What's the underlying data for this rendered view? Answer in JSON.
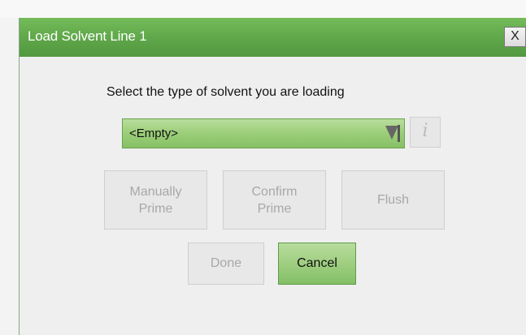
{
  "dialog": {
    "title": "Load Solvent Line 1",
    "close_label": "X",
    "prompt": "Select the type of solvent you are loading",
    "solvent_select": {
      "value": "<Empty>",
      "icon": "dropdown-arrow"
    },
    "info_button": {
      "label": "i",
      "icon": "info-icon"
    },
    "buttons": {
      "manual_prime_line1": "Manually",
      "manual_prime_line2": "Prime",
      "confirm_prime_line1": "Confirm",
      "confirm_prime_line2": "Prime",
      "flush": "Flush",
      "done": "Done",
      "cancel": "Cancel"
    }
  },
  "colors": {
    "titlebar": "#5ea649",
    "accent_green": "#9ccd7d",
    "disabled_text": "#a8a8a8"
  }
}
